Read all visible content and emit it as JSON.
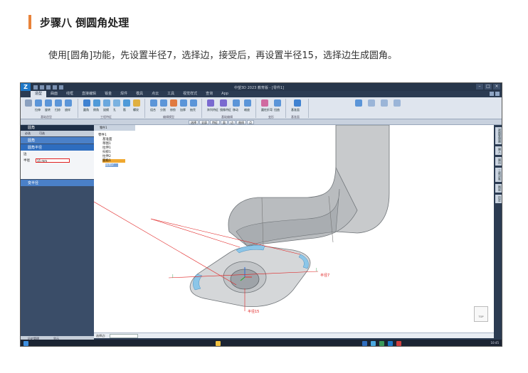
{
  "article": {
    "step_title": "步骤八  倒圆角处理",
    "description": "使用[圆角]功能，先设置半径7，选择边，接受后，再设置半径15，选择边生成圆角。",
    "accent_color": "#e8833a"
  },
  "app": {
    "window_title": "中望3D 2023  教育版 - [零件1]",
    "ribbon_tabs": [
      "造型",
      "曲面",
      "线框",
      "直接编辑",
      "钣金",
      "焊件",
      "模具",
      "点云",
      "工具",
      "视觉样式",
      "查询",
      "App"
    ],
    "active_tab": "造型",
    "ribbon_groups": [
      {
        "name": "基础造型",
        "tools": [
          "拉伸",
          "旋转",
          "扫掠",
          "放样"
        ]
      },
      {
        "name": "工程特征",
        "tools": [
          "圆角",
          "倒角",
          "拔模",
          "孔",
          "筋",
          "螺纹"
        ]
      },
      {
        "name": "编辑模型",
        "tools": [
          "组合",
          "分割",
          "修剪",
          "加厚",
          "抽壳"
        ]
      },
      {
        "name": "基础编辑",
        "tools": [
          "阵列特征",
          "镜像特征",
          "移动",
          "缩放"
        ]
      },
      {
        "name": "变形",
        "tools": [
          "圆柱折弯",
          "扭曲"
        ]
      },
      {
        "name": "基准面",
        "tools": [
          "基准面"
        ]
      }
    ],
    "selection_bar": [
      "选择",
      "全部",
      "特征",
      "面",
      "边",
      "曲线",
      "点"
    ],
    "left_panel": {
      "header": "圆角",
      "tabs": [
        "必选",
        "可选"
      ],
      "buttons": [
        "圆角",
        "圆角半径"
      ],
      "fields": [
        {
          "label": "边",
          "value": ""
        },
        {
          "label": "半径",
          "value": "15 mm"
        }
      ],
      "section_more": "变半径",
      "bottom_tabs": [
        "历史管理",
        "显示"
      ]
    },
    "document_tab": "零件1",
    "tree": [
      "零件1",
      "基准面",
      "草图1",
      "拉伸1",
      "扫掠1",
      "拉伸2",
      "圆角1",
      "圆角2"
    ],
    "annotations": [
      "半径7",
      "半径15"
    ],
    "viewcube_label": "TOP",
    "command_prompt": "选择边:",
    "command_input": "",
    "right_dock": [
      "视图管理器",
      "输入",
      "输出",
      "三维对象",
      "图层",
      "历史"
    ],
    "taskbar_time": "10:45",
    "colors": {
      "titlebar": "#27364b",
      "ribbon": "#dfe5ee",
      "panel_blue": "#4a80c8",
      "highlight_orange": "#f0a830",
      "annotation_red": "#e02020",
      "part_face": "#c8cacc",
      "fillet_face": "#8cc6e8"
    }
  }
}
